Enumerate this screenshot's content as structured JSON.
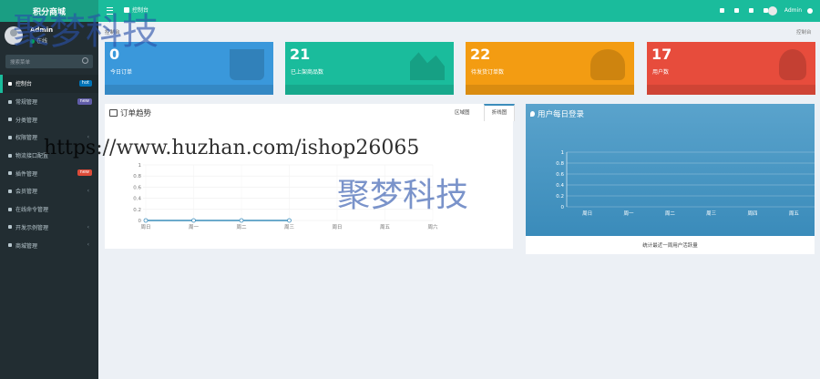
{
  "brand": {
    "name": "积分商城"
  },
  "user": {
    "name": "Admin",
    "status": "在线"
  },
  "search": {
    "placeholder": "搜索菜单"
  },
  "menu": [
    {
      "label": "控制台",
      "badge": "hot",
      "badge_color": "#0073b7",
      "active": true
    },
    {
      "label": "常规管理",
      "badge": "new",
      "badge_color": "#605ca8"
    },
    {
      "label": "分类管理"
    },
    {
      "label": "权限管理",
      "chevron": "‹"
    },
    {
      "label": "物流接口配置"
    },
    {
      "label": "插件管理",
      "badge": "new",
      "badge_color": "#dd4b39"
    },
    {
      "label": "会员管理",
      "chevron": "‹"
    },
    {
      "label": "在线命令管理"
    },
    {
      "label": "开发示例管理",
      "chevron": "‹"
    },
    {
      "label": "商城管理",
      "chevron": "‹"
    }
  ],
  "topbar": {
    "home_label": "控制台",
    "admin_label": "Admin"
  },
  "breadcrumb": {
    "left": "控制台",
    "right": "控制台"
  },
  "stats": [
    {
      "value": "0",
      "label": "今日订单",
      "color": "#3a98db",
      "icon": "cart-icon"
    },
    {
      "value": "21",
      "label": "已上架商品数",
      "color": "#1abc9c",
      "icon": "area-chart-icon"
    },
    {
      "value": "22",
      "label": "待发货订单数",
      "color": "#f39c12",
      "icon": "users-icon"
    },
    {
      "value": "17",
      "label": "用户数",
      "color": "#e74c3c",
      "icon": "user-icon"
    }
  ],
  "order_panel": {
    "title": "订单趋势",
    "tab_area": "区域图",
    "tab_line": "折线图"
  },
  "login_panel": {
    "title": "用户每日登录",
    "footer": "统计最近一周用户活跃量"
  },
  "chart_data": [
    {
      "type": "line",
      "categories": [
        "周日",
        "周一",
        "周二",
        "周三",
        "周日",
        "周五",
        "周六"
      ],
      "series": [
        {
          "values": [
            0,
            0,
            0,
            0
          ]
        }
      ],
      "ylim": [
        0,
        1
      ],
      "yticks": [
        "0",
        "0.2",
        "0.4",
        "0.6",
        "0.8",
        "1"
      ],
      "grid": true,
      "color": "#3c8dbc"
    },
    {
      "type": "line",
      "categories": [
        "周日",
        "周一",
        "周二",
        "周三",
        "周四",
        "周五"
      ],
      "series": [
        {
          "values": []
        }
      ],
      "ylim": [
        0,
        1
      ],
      "yticks": [
        "0",
        "0.2",
        "0.4",
        "0.6",
        "0.8",
        "1"
      ],
      "grid": true
    }
  ],
  "watermarks": [
    "聚梦科技",
    "https://www.huzhan.com/ishop26065",
    "聚梦科技"
  ]
}
